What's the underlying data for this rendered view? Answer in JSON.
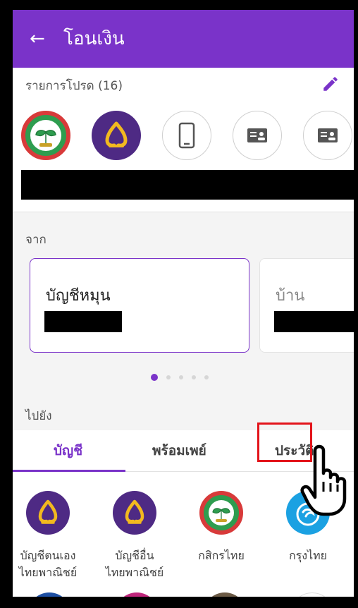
{
  "header": {
    "back_icon": "arrow-left-icon",
    "title": "โอนเงิน",
    "color": "#7A33C9"
  },
  "favorites": {
    "title": "รายการโปรด (16)",
    "edit_icon": "pencil-icon",
    "items": [
      "kasikorn-logo",
      "scb-logo",
      "phone-icon",
      "id-card-icon",
      "id-card-icon"
    ]
  },
  "from": {
    "label": "จาก",
    "accounts": [
      {
        "name": "บัญชีหมุน"
      },
      {
        "name": "บ้าน"
      }
    ],
    "page_dots": 5,
    "active_dot": 1
  },
  "to": {
    "label": "ไปยัง",
    "tabs": [
      {
        "label": "บัญชี",
        "active": true
      },
      {
        "label": "พร้อมเพย์",
        "active": false
      },
      {
        "label": "ประวัติ",
        "active": false
      }
    ]
  },
  "banks": [
    {
      "line1": "บัญชีตนเอง",
      "line2": "ไทยพาณิชย์"
    },
    {
      "line1": "บัญชีอื่น",
      "line2": "ไทยพาณิชย์"
    },
    {
      "line1": "กสิกรไทย",
      "line2": ""
    },
    {
      "line1": "กรุงไทย",
      "line2": ""
    }
  ],
  "colors": {
    "accent": "#7A33C9",
    "highlight": "#E3141B"
  }
}
